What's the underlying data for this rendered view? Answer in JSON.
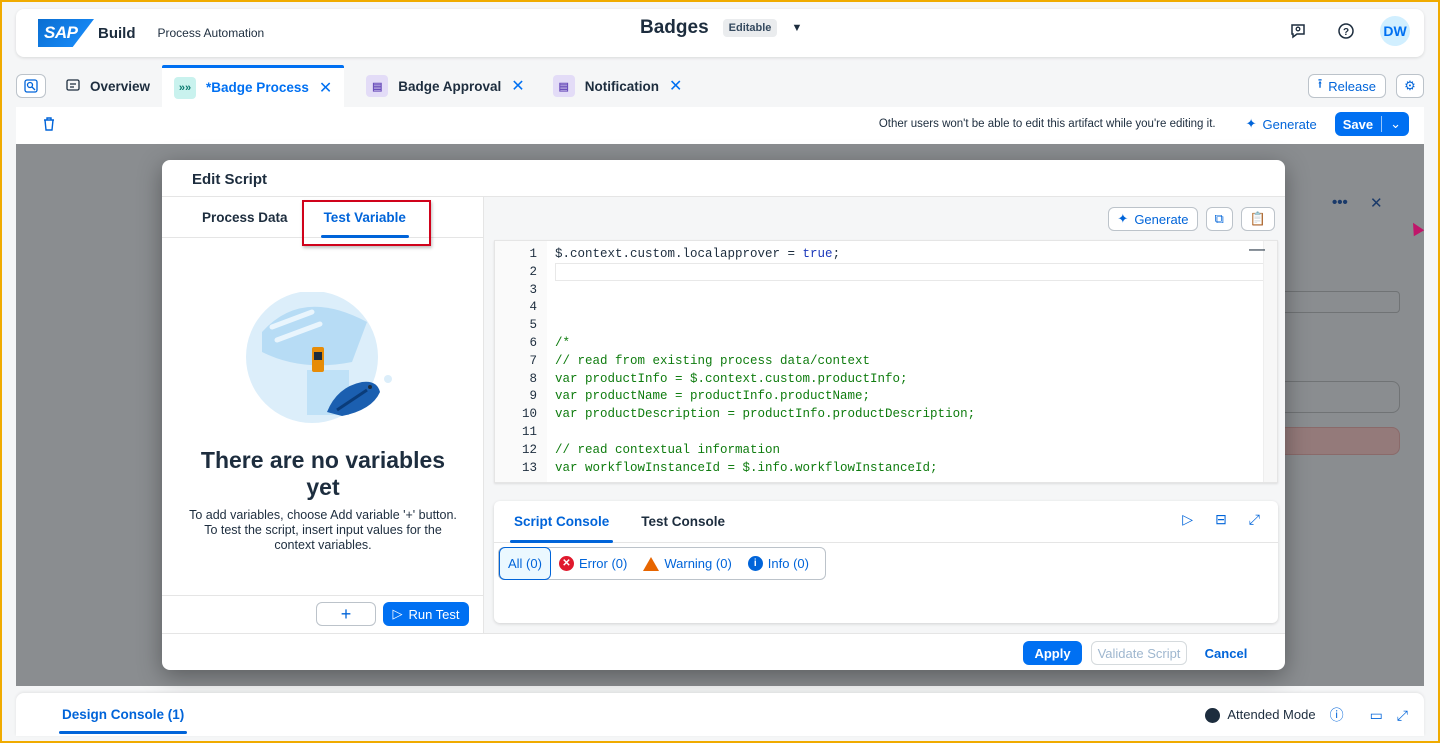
{
  "shell": {
    "logo": "SAP",
    "product": "Build",
    "subtitle": "Process Automation",
    "title": "Badges",
    "status_badge": "Editable",
    "avatar": "DW"
  },
  "tabs": [
    {
      "label": "Overview"
    },
    {
      "label": "*Badge Process"
    },
    {
      "label": "Badge Approval"
    },
    {
      "label": "Notification"
    }
  ],
  "header_actions": {
    "release": "Release"
  },
  "toolbar": {
    "notice": "Other users won't be able to edit this artifact while you're editing it.",
    "generate": "Generate",
    "save": "Save"
  },
  "dialog": {
    "title": "Edit Script",
    "left_tabs": [
      "Process Data",
      "Test Variable"
    ],
    "empty_title": "There are no variables yet",
    "empty_desc": "To add variables, choose Add variable '+' button. To test the script, insert input values for the context variables.",
    "add_button": "+",
    "run_test": "Run Test",
    "generate": "Generate",
    "code_lines": [
      {
        "n": "1",
        "text": "$.context.custom.localapprover = ",
        "kw": "true",
        "tail": ";",
        "type": "code"
      },
      {
        "n": "2",
        "text": "",
        "type": "code"
      },
      {
        "n": "3",
        "text": "",
        "type": "code"
      },
      {
        "n": "4",
        "text": "",
        "type": "code"
      },
      {
        "n": "5",
        "text": "",
        "type": "code"
      },
      {
        "n": "6",
        "text": "/*",
        "type": "cm"
      },
      {
        "n": "7",
        "text": "// read from existing process data/context",
        "type": "cm"
      },
      {
        "n": "8",
        "text": "var productInfo = $.context.custom.productInfo;",
        "type": "cm"
      },
      {
        "n": "9",
        "text": "var productName = productInfo.productName;",
        "type": "cm"
      },
      {
        "n": "10",
        "text": "var productDescription = productInfo.productDescription;",
        "type": "cm"
      },
      {
        "n": "11",
        "text": "",
        "type": "cm"
      },
      {
        "n": "12",
        "text": "// read contextual information",
        "type": "cm"
      },
      {
        "n": "13",
        "text": "var workflowInstanceId = $.info.workflowInstanceId;",
        "type": "cm"
      }
    ],
    "console_tabs": [
      "Script Console",
      "Test Console"
    ],
    "filters": [
      "All (0)",
      "Error (0)",
      "Warning (0)",
      "Info (0)"
    ],
    "apply": "Apply",
    "validate": "Validate Script",
    "cancel": "Cancel"
  },
  "bottom": {
    "design_console": "Design Console (1)",
    "mode": "Attended Mode"
  },
  "colors": {
    "accent": "#0070f2",
    "highlight": "#d0021b",
    "frame": "#f0ab00"
  }
}
